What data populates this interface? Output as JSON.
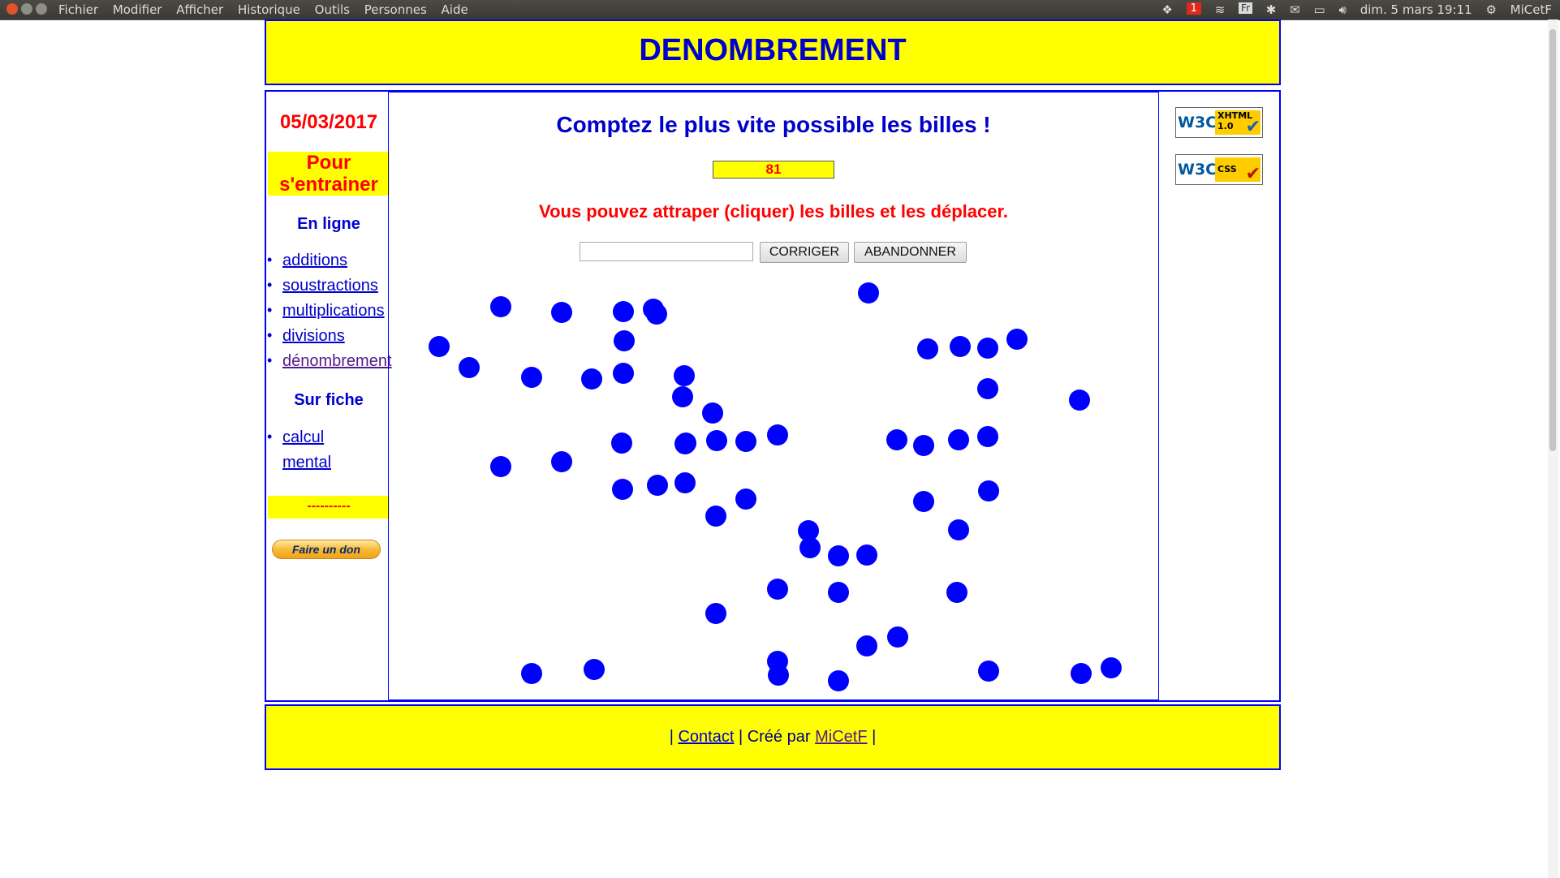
{
  "topbar": {
    "menu": [
      "Fichier",
      "Modifier",
      "Afficher",
      "Historique",
      "Outils",
      "Personnes",
      "Aide"
    ],
    "notification_count": "1",
    "keyboard": "Fr",
    "datetime": "dim. 5 mars 19:11",
    "user": "MiCetF"
  },
  "header": {
    "title": "DENOMBREMENT"
  },
  "sidebar": {
    "date": "05/03/2017",
    "train_title": "Pour s'entrainer",
    "online_heading": "En ligne",
    "online_items": [
      {
        "label": "additions"
      },
      {
        "label": "soustractions"
      },
      {
        "label": "multiplications"
      },
      {
        "label": "divisions"
      },
      {
        "label": "dénombrement"
      }
    ],
    "sheet_heading": "Sur fiche",
    "sheet_items": [
      {
        "label": "calcul"
      },
      {
        "label": "mental"
      }
    ],
    "separator": "----------",
    "donate_label": "Faire un don"
  },
  "game": {
    "prompt": "Comptez le plus vite possible les billes !",
    "counter": "81",
    "instruction": "Vous pouvez attraper (cliquer) les billes et les déplacer.",
    "answer_value": "",
    "correct_label": "CORRIGER",
    "abandon_label": "ABANDONNER",
    "marble_color": "#0000ff",
    "marble_count": 59
  },
  "validators": [
    {
      "logo": "W3C",
      "label_line1": "XHTML",
      "label_line2": "1.0",
      "check_color": "#1a5fb4"
    },
    {
      "logo": "W3C",
      "label_line1": "CSS",
      "label_line2": "",
      "check_color": "#b01515"
    }
  ],
  "footer": {
    "sep_open": "|",
    "contact_label": "Contact",
    "created_by": "| Créé par",
    "author_label": "MiCetF",
    "sep_close": "|"
  },
  "colors": {
    "accent_yellow": "#ffff00",
    "border_blue": "#0000ff",
    "title_blue": "#0000cc",
    "alert_red": "#ff0000"
  }
}
